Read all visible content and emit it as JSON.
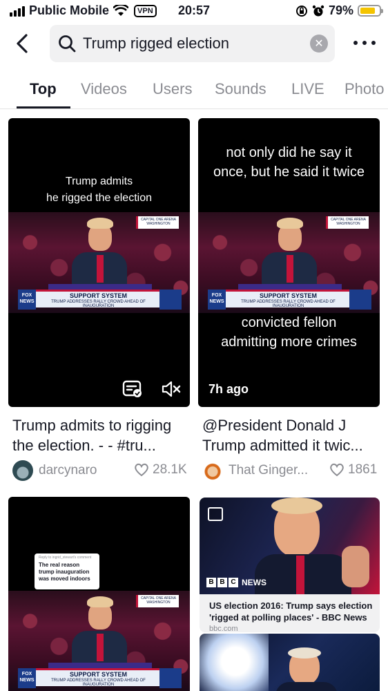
{
  "status_bar": {
    "carrier": "Public Mobile",
    "vpn": "VPN",
    "time": "20:57",
    "battery": "79%",
    "battery_level": 0.79,
    "battery_color": "#f4c400"
  },
  "search": {
    "query": "Trump rigged election",
    "back_icon": "chevron-left-icon",
    "search_icon": "magnifier-icon",
    "clear_icon": "clear-x-icon",
    "more_icon": "more-dots-icon"
  },
  "tabs": [
    {
      "label": "Top",
      "active": true
    },
    {
      "label": "Videos",
      "active": false
    },
    {
      "label": "Users",
      "active": false
    },
    {
      "label": "Sounds",
      "active": false
    },
    {
      "label": "LIVE",
      "active": false
    },
    {
      "label": "Photo",
      "active": false
    }
  ],
  "results": [
    {
      "overlay_top": [
        "Trump admits",
        "he rigged the election"
      ],
      "chyron_title": "SUPPORT SYSTEM",
      "chyron_sub": "TRUMP ADDRESSES RALLY CROWD AHEAD OF INAUGURATION",
      "title_lines": [
        "Trump admits to rigging",
        "the election.  - - #tru..."
      ],
      "author": "darcynaro",
      "likes": "28.1K"
    },
    {
      "overlay_top": [
        "not only did he say it",
        "once, but he said it twice"
      ],
      "overlay_bottom": [
        "convicted fellon",
        "admitting more crimes"
      ],
      "chyron_title": "SUPPORT SYSTEM",
      "chyron_sub": "TRUMP ADDRESSES RALLY CROWD AHEAD OF INAUGURATION",
      "time_ago": "7h ago",
      "title_lines": [
        "@President Donald J",
        "Trump admitted it twic..."
      ],
      "author": "That Ginger...",
      "likes": "1861"
    },
    {
      "reply_label": "Reply to ingrid_stewart's comment",
      "reply_text": [
        "The real reason",
        "trump inauguration",
        "was moved indoors"
      ],
      "chyron_title": "SUPPORT SYSTEM",
      "chyron_sub": "TRUMP ADDRESSES RALLY CROWD AHEAD OF INAUGURATION"
    },
    {
      "source_logo": "NEWS",
      "link_title": "US election 2016: Trump says election 'rigged at polling places' - BBC News",
      "link_domain": "bbc.com"
    }
  ]
}
